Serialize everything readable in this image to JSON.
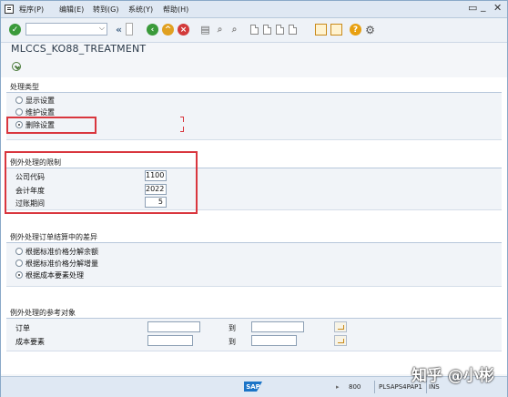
{
  "menubar": {
    "items": [
      "程序(P)",
      "编辑(E)",
      "转到(G)",
      "系统(Y)",
      "帮助(H)"
    ],
    "window_controls": [
      "restore",
      "minimize",
      "close"
    ]
  },
  "toolbar": {
    "icons": [
      "enter-icon",
      "back-icon",
      "exit-icon",
      "cancel-icon",
      "print-icon",
      "find-icon",
      "find-next-icon",
      "first-page-icon",
      "prev-page-icon",
      "next-page-icon",
      "last-page-icon",
      "new-session-icon",
      "shortcut-icon",
      "help-icon",
      "customize-icon"
    ]
  },
  "title": "MLCCS_KO88_TREATMENT",
  "group1": {
    "title": "处理类型",
    "options": [
      {
        "label": "显示设置",
        "selected": false
      },
      {
        "label": "维护设置",
        "selected": false
      },
      {
        "label": "删除设置",
        "selected": true
      }
    ]
  },
  "group2": {
    "title": "例外处理的限制",
    "fields": [
      {
        "label": "公司代码",
        "value": "1100"
      },
      {
        "label": "会计年度",
        "value": "2022"
      },
      {
        "label": "过账期间",
        "value": "5"
      }
    ]
  },
  "group3": {
    "title": "例外处理订单结算中的差异",
    "options": [
      {
        "label": "根据标准价格分解余额",
        "selected": false
      },
      {
        "label": "根据标准价格分解增量",
        "selected": false
      },
      {
        "label": "根据成本要素处理",
        "selected": true
      }
    ]
  },
  "group4": {
    "title": "例外处理的参考对象",
    "rows": [
      {
        "label": "订单",
        "to": "到",
        "from_value": "",
        "to_value": ""
      },
      {
        "label": "成本要素",
        "to": "到",
        "from_value": "",
        "to_value": ""
      }
    ]
  },
  "statusbar": {
    "logo": "SAP",
    "client": "800",
    "server": "PLSAPS4PAP1",
    "mode": "INS"
  },
  "watermark": "知乎 @小彬",
  "colors": {
    "highlight": "#d9363e",
    "accent": "#1b74c7"
  }
}
